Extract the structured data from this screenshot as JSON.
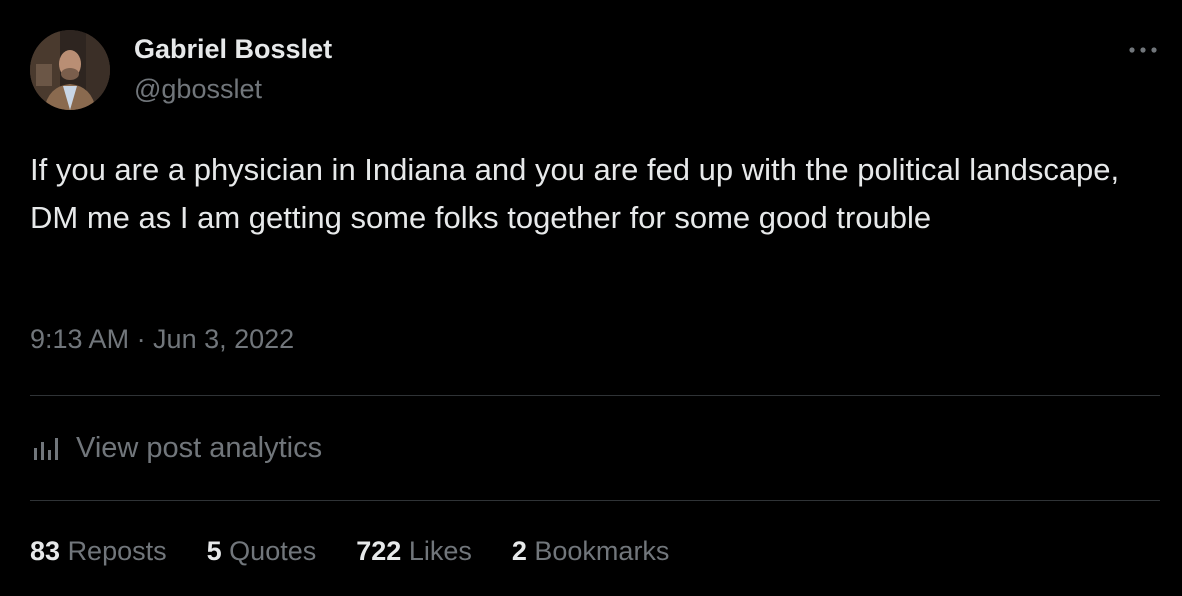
{
  "author": {
    "name": "Gabriel Bosslet",
    "handle": "@gbosslet"
  },
  "more_icon": "more-horizontal-icon",
  "post": {
    "text": "If you are a physician in Indiana and you are fed up with the political landscape, DM me as I am getting some folks together for some good trouble",
    "timestamp": "9:13 AM · Jun 3, 2022"
  },
  "analytics": {
    "icon": "bar-chart-icon",
    "label": "View post analytics"
  },
  "stats": {
    "reposts": {
      "count": "83",
      "label": "Reposts"
    },
    "quotes": {
      "count": "5",
      "label": "Quotes"
    },
    "likes": {
      "count": "722",
      "label": "Likes"
    },
    "bookmarks": {
      "count": "2",
      "label": "Bookmarks"
    }
  },
  "colors": {
    "background": "#000000",
    "primary_text": "#e7e9ea",
    "secondary_text": "#71767b",
    "divider": "#2f3336"
  }
}
